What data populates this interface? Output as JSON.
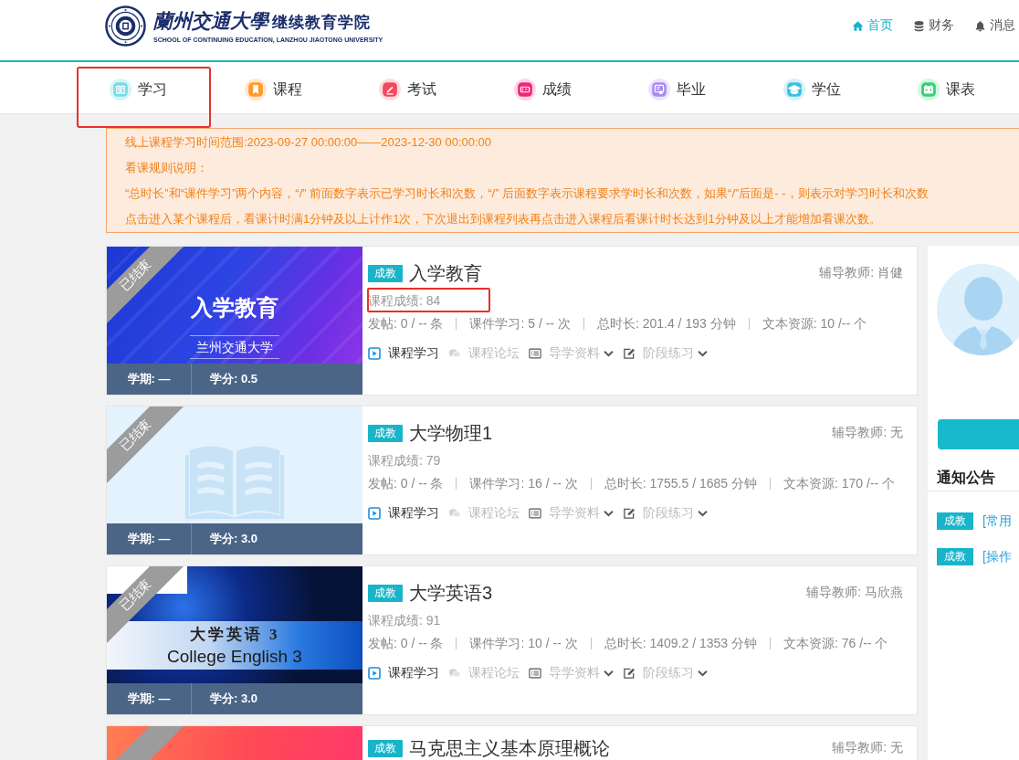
{
  "header": {
    "logo": {
      "name": "蘭州交通大學",
      "school": "继续教育学院",
      "english": "SCHOOL OF CONTINUING EDUCATION, LANZHOU JIAOTONG UNIVERSITY"
    },
    "links": [
      {
        "label": "首页",
        "selected": true
      },
      {
        "label": "财务",
        "selected": false
      },
      {
        "label": "消息",
        "selected": false
      }
    ]
  },
  "nav": {
    "items": [
      {
        "label": "学习",
        "annotated": true
      },
      {
        "label": "课程",
        "annotated": false
      },
      {
        "label": "考试",
        "annotated": false
      },
      {
        "label": "成绩",
        "annotated": false
      },
      {
        "label": "毕业",
        "annotated": false
      },
      {
        "label": "学位",
        "annotated": false
      },
      {
        "label": "课表",
        "annotated": false
      }
    ]
  },
  "notice": {
    "lines": [
      "线上课程学习时间范围:2023-09-27 00:00:00——2023-12-30 00:00:00",
      "看课规则说明：",
      "“总时长”和“课件学习”两个内容，“/” 前面数字表示已学习时长和次数，“/” 后面数字表示课程要求学时长和次数，如果“/”后面是- -，则表示对学习时长和次数",
      "点击进入某个课程后，看课计时满1分钟及以上计作1次，下次退出到课程列表再点击进入课程后看课计时长达到1分钟及以上才能增加看课次数。"
    ]
  },
  "courses": [
    {
      "ended": true,
      "status": "已结束",
      "cover": {
        "kind": "banner",
        "lines": [
          "入学教育",
          "兰州交通大学"
        ]
      },
      "term": "学期: —",
      "credit": "学分: 0.5",
      "badge": "成教",
      "title": "入学教育",
      "tutor": "辅导教师: 肖健",
      "score": "课程成绩: 84",
      "score_annotated": true,
      "stats": [
        "发帖: 0 / -- 条",
        "课件学习: 5 / -- 次",
        "总时长: 201.4 / 193 分钟",
        "文本资源: 10 /-- 个"
      ],
      "actions": [
        {
          "label": "课程学习",
          "disabled": false,
          "dropdown": false
        },
        {
          "label": "课程论坛",
          "disabled": true,
          "dropdown": false
        },
        {
          "label": "导学资料",
          "disabled": true,
          "dropdown": true
        },
        {
          "label": "阶段练习",
          "disabled": true,
          "dropdown": true
        }
      ]
    },
    {
      "ended": true,
      "status": "已结束",
      "cover": {
        "kind": "book"
      },
      "term": "学期: —",
      "credit": "学分: 3.0",
      "badge": "成教",
      "title": "大学物理1",
      "tutor": "辅导教师: 无",
      "score": "课程成绩: 79",
      "score_annotated": false,
      "stats": [
        "发帖: 0 / -- 条",
        "课件学习: 16 / -- 次",
        "总时长: 1755.5 / 1685 分钟",
        "文本资源: 170 /-- 个"
      ],
      "actions": [
        {
          "label": "课程学习",
          "disabled": false,
          "dropdown": false
        },
        {
          "label": "课程论坛",
          "disabled": true,
          "dropdown": false
        },
        {
          "label": "导学资料",
          "disabled": true,
          "dropdown": true
        },
        {
          "label": "阶段练习",
          "disabled": true,
          "dropdown": true
        }
      ]
    },
    {
      "ended": true,
      "status": "已结束",
      "cover": {
        "kind": "photo",
        "lines": [
          "大学英语 3",
          "College English 3"
        ]
      },
      "term": "学期: —",
      "credit": "学分: 3.0",
      "badge": "成教",
      "title": "大学英语3",
      "tutor": "辅导教师: 马欣燕",
      "score": "课程成绩: 91",
      "score_annotated": false,
      "stats": [
        "发帖: 0 / -- 条",
        "课件学习: 10 / -- 次",
        "总时长: 1409.2 / 1353 分钟",
        "文本资源: 76 /-- 个"
      ],
      "actions": [
        {
          "label": "课程学习",
          "disabled": false,
          "dropdown": false
        },
        {
          "label": "课程论坛",
          "disabled": true,
          "dropdown": false
        },
        {
          "label": "导学资料",
          "disabled": true,
          "dropdown": true
        },
        {
          "label": "阶段练习",
          "disabled": true,
          "dropdown": true
        }
      ]
    },
    {
      "ended": true,
      "cover": {
        "kind": "gradient"
      },
      "badge": "成教",
      "title": "马克思主义基本原理概论",
      "tutor": "辅导教师: 无"
    }
  ],
  "sidebar": {
    "notices_title": "通知公告",
    "notices": [
      {
        "badge": "成教",
        "title": "[常用"
      },
      {
        "badge": "成教",
        "title": "[操作"
      }
    ]
  }
}
